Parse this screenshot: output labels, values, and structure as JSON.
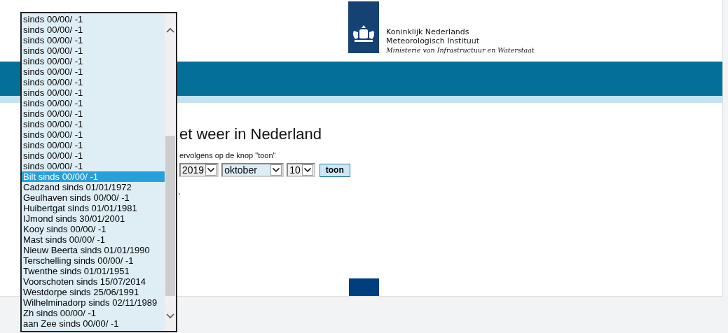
{
  "logo": {
    "lines": [
      "Koninklijk Nederlands",
      "Meteorologisch Instituut"
    ],
    "subline": "Ministerie van Infrastructuur en Waterstaat"
  },
  "heading": "et weer in Nederland",
  "instruction": "ervolgens op de knop \"toon\"",
  "selects": [
    {
      "value": "2019",
      "focused": false
    },
    {
      "value": "oktober",
      "focused": true
    },
    {
      "value": "10",
      "focused": false
    }
  ],
  "button": "toon",
  "note": ".",
  "dropdown": {
    "options": [
      {
        "label": "sinds 00/00/ -1",
        "selected": false
      },
      {
        "label": "sinds 00/00/ -1",
        "selected": false
      },
      {
        "label": "sinds 00/00/ -1",
        "selected": false
      },
      {
        "label": "sinds 00/00/ -1",
        "selected": false
      },
      {
        "label": "sinds 00/00/ -1",
        "selected": false
      },
      {
        "label": "sinds 00/00/ -1",
        "selected": false
      },
      {
        "label": "sinds 00/00/ -1",
        "selected": false
      },
      {
        "label": "sinds 00/00/ -1",
        "selected": false
      },
      {
        "label": "sinds 00/00/ -1",
        "selected": false
      },
      {
        "label": "sinds 00/00/ -1",
        "selected": false
      },
      {
        "label": "sinds 00/00/ -1",
        "selected": false
      },
      {
        "label": "sinds 00/00/ -1",
        "selected": false
      },
      {
        "label": "sinds 00/00/ -1",
        "selected": false
      },
      {
        "label": "sinds 00/00/ -1",
        "selected": false
      },
      {
        "label": "sinds 00/00/ -1",
        "selected": false
      },
      {
        "label": "Bilt sinds 00/00/ -1",
        "selected": true
      },
      {
        "label": "Cadzand sinds 01/01/1972",
        "selected": false
      },
      {
        "label": "Geulhaven sinds 00/00/ -1",
        "selected": false
      },
      {
        "label": "Huibertgat sinds 01/01/1981",
        "selected": false
      },
      {
        "label": "IJmond sinds 30/01/2001",
        "selected": false
      },
      {
        "label": "Kooy sinds 00/00/ -1",
        "selected": false
      },
      {
        "label": "Mast sinds 00/00/ -1",
        "selected": false
      },
      {
        "label": "Nieuw Beerta sinds 01/01/1990",
        "selected": false
      },
      {
        "label": "Terschelling sinds 00/00/ -1",
        "selected": false
      },
      {
        "label": "Twenthe sinds 01/01/1951",
        "selected": false
      },
      {
        "label": "Voorschoten sinds 15/07/2014",
        "selected": false
      },
      {
        "label": "Westdorpe sinds 25/06/1991",
        "selected": false
      },
      {
        "label": "Wilhelminadorp sinds 02/11/1989",
        "selected": false
      },
      {
        "label": "Zh sinds 00/00/ -1",
        "selected": false
      },
      {
        "label": "aan Zee sinds 00/00/ -1",
        "selected": false
      }
    ]
  }
}
